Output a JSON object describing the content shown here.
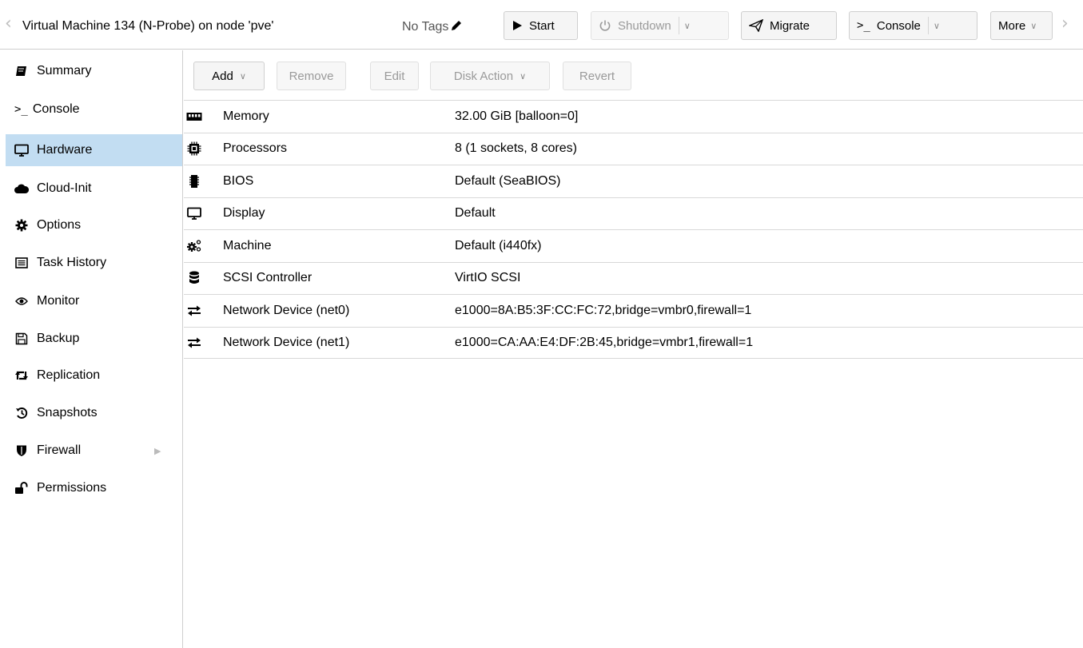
{
  "header": {
    "title": "Virtual Machine 134 (N-Probe) on node 'pve'",
    "tags_label": "No Tags",
    "buttons": {
      "start": "Start",
      "shutdown": "Shutdown",
      "migrate": "Migrate",
      "console": "Console",
      "more": "More"
    }
  },
  "sidebar": {
    "active": "Hardware",
    "items": [
      {
        "label": "Summary",
        "icon": "book-icon"
      },
      {
        "label": "Console",
        "icon": "terminal-icon"
      },
      {
        "label": "Hardware",
        "icon": "desktop-icon"
      },
      {
        "label": "Cloud-Init",
        "icon": "cloud-icon"
      },
      {
        "label": "Options",
        "icon": "gear-icon"
      },
      {
        "label": "Task History",
        "icon": "list-icon"
      },
      {
        "label": "Monitor",
        "icon": "eye-icon"
      },
      {
        "label": "Backup",
        "icon": "floppy-icon"
      },
      {
        "label": "Replication",
        "icon": "retweet-icon"
      },
      {
        "label": "Snapshots",
        "icon": "history-icon"
      },
      {
        "label": "Firewall",
        "icon": "shield-icon"
      },
      {
        "label": "Permissions",
        "icon": "unlock-icon"
      }
    ]
  },
  "toolbar": {
    "add": "Add",
    "remove": "Remove",
    "edit": "Edit",
    "disk_action": "Disk Action",
    "revert": "Revert"
  },
  "hardware": [
    {
      "name": "Memory",
      "value": "32.00 GiB [balloon=0]",
      "icon": "memory-icon"
    },
    {
      "name": "Processors",
      "value": "8 (1 sockets, 8 cores)",
      "icon": "cpu-icon"
    },
    {
      "name": "BIOS",
      "value": "Default (SeaBIOS)",
      "icon": "microchip-icon"
    },
    {
      "name": "Display",
      "value": "Default",
      "icon": "desktop-icon"
    },
    {
      "name": "Machine",
      "value": "Default (i440fx)",
      "icon": "cogs-icon"
    },
    {
      "name": "SCSI Controller",
      "value": "VirtIO SCSI",
      "icon": "database-icon"
    },
    {
      "name": "Network Device (net0)",
      "value": "e1000=8A:B5:3F:CC:FC:72,bridge=vmbr0,firewall=1",
      "icon": "exchange-icon"
    },
    {
      "name": "Network Device (net1)",
      "value": "e1000=CA:AA:E4:DF:2B:45,bridge=vmbr1,firewall=1",
      "icon": "exchange-icon"
    }
  ],
  "colors": {
    "active_bg": "#c2ddf2",
    "border": "#cfcfcf",
    "disabled_text": "#9a9a9a"
  }
}
